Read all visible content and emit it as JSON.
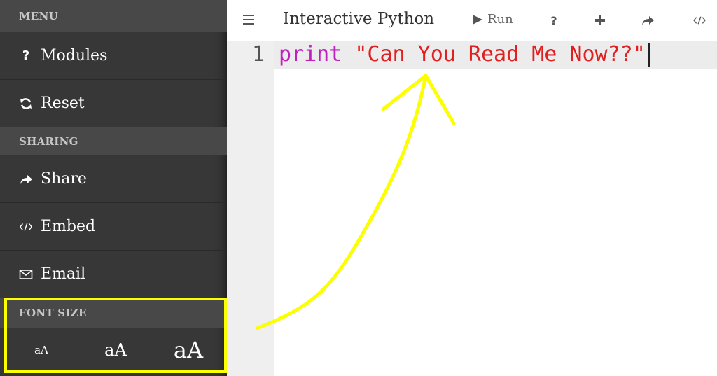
{
  "colors": {
    "sidebar_bg": "#373737",
    "section_header_bg": "#484848",
    "highlight": "#fbff00",
    "keyword": "#c020c0",
    "string": "#e02020",
    "gutter_bg": "#efefef"
  },
  "sidebar": {
    "menu_header": "MENU",
    "items": [
      {
        "label": "Modules",
        "icon": "question-icon"
      },
      {
        "label": "Reset",
        "icon": "refresh-icon"
      }
    ],
    "sharing_header": "SHARING",
    "sharing_items": [
      {
        "label": "Share",
        "icon": "share-icon"
      },
      {
        "label": "Embed",
        "icon": "code-icon"
      },
      {
        "label": "Email",
        "icon": "envelope-icon"
      }
    ],
    "font_size_header": "FONT SIZE",
    "font_sizes": [
      {
        "label": "aA",
        "size": "small"
      },
      {
        "label": "aA",
        "size": "medium"
      },
      {
        "label": "aA",
        "size": "large"
      }
    ]
  },
  "toolbar": {
    "title": "Interactive Python",
    "run_label": "Run",
    "icons": [
      "menu-icon",
      "play-icon",
      "question-icon",
      "plus-icon",
      "share-icon",
      "code-icon"
    ]
  },
  "editor": {
    "line_number": "1",
    "keyword": "print",
    "space": " ",
    "string": "\"Can You Read Me Now??\""
  }
}
